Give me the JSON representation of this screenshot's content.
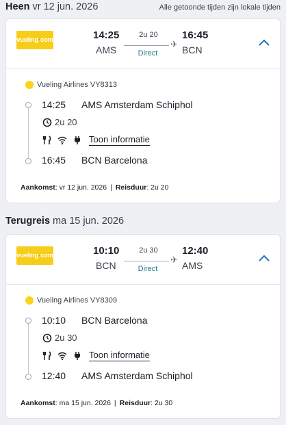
{
  "header_note": "Alle getoonde tijden zijn lokale tijden",
  "outbound": {
    "title": "Heen",
    "date": "vr 12 jun. 2026",
    "summary": {
      "logo_text_a": "vueling",
      "logo_text_b": "com",
      "dep_time": "14:25",
      "dep_code": "AMS",
      "duration": "2u 20",
      "stops": "Direct",
      "arr_time": "16:45",
      "arr_code": "BCN"
    },
    "detail": {
      "airline": "Vueling Airlines VY8313",
      "dep_time": "14:25",
      "dep_airport": "AMS Amsterdam Schiphol",
      "duration": "2u 20",
      "info_link": "Toon informatie",
      "arr_time": "16:45",
      "arr_airport": "BCN Barcelona",
      "arrival_label": "Aankomst",
      "arrival_value": ": vr 12 jun. 2026",
      "travel_label": "Reisduur",
      "travel_value": ": 2u 20"
    }
  },
  "return": {
    "title": "Terugreis",
    "date": "ma 15 jun. 2026",
    "summary": {
      "logo_text_a": "vueling",
      "logo_text_b": "com",
      "dep_time": "10:10",
      "dep_code": "BCN",
      "duration": "2u 30",
      "stops": "Direct",
      "arr_time": "12:40",
      "arr_code": "AMS"
    },
    "detail": {
      "airline": "Vueling Airlines VY8309",
      "dep_time": "10:10",
      "dep_airport": "BCN Barcelona",
      "duration": "2u 30",
      "info_link": "Toon informatie",
      "arr_time": "12:40",
      "arr_airport": "AMS Amsterdam Schiphol",
      "arrival_label": "Aankomst",
      "arrival_value": ": ma 15 jun. 2026",
      "travel_label": "Reisduur",
      "travel_value": ": 2u 30"
    }
  },
  "separator": "|",
  "colors": {
    "accent_link": "#1d7a8c",
    "chevron": "#1f6fb5",
    "vueling_yellow": "#f7cd1a"
  },
  "icons": [
    "meal-icon",
    "wifi-icon",
    "power-plug-icon",
    "clock-icon",
    "plane-icon",
    "chevron-up-icon"
  ]
}
